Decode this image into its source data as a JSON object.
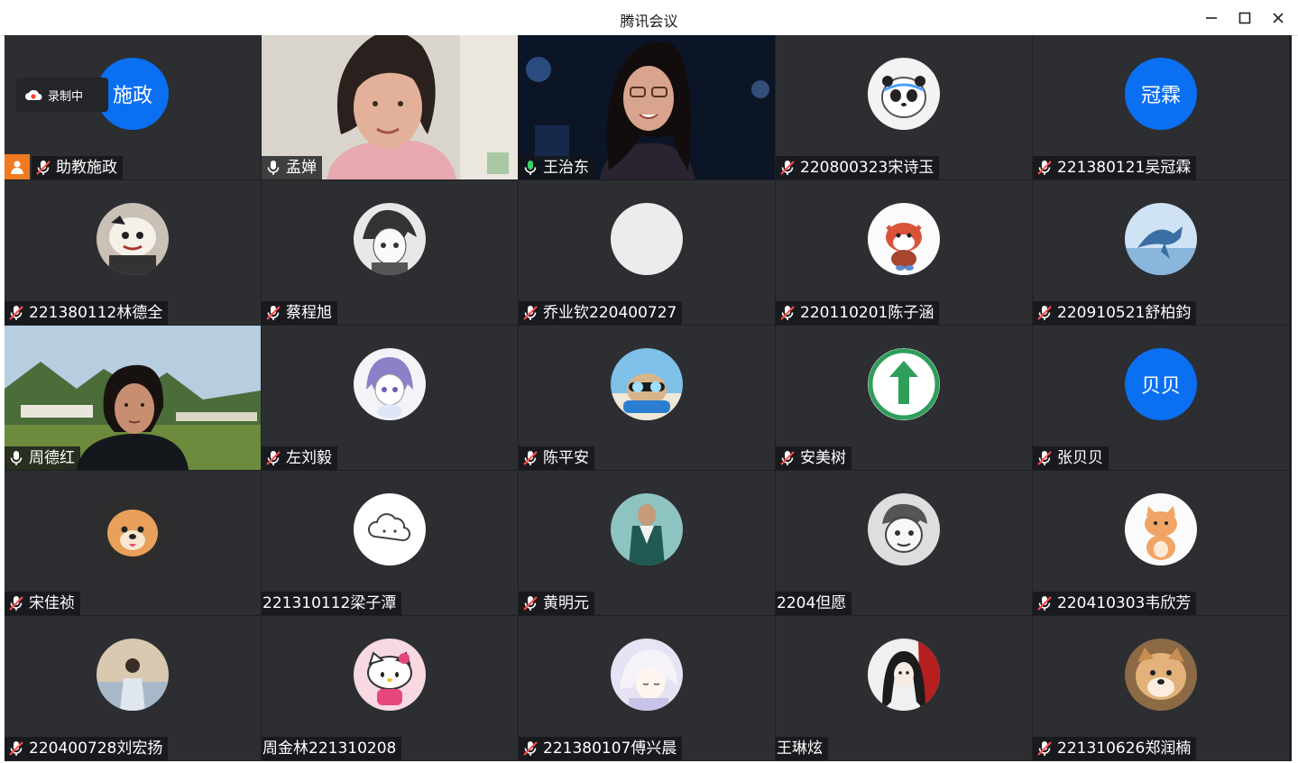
{
  "window": {
    "title": "腾讯会议"
  },
  "recording": {
    "label": "录制中"
  },
  "colors": {
    "accent": "#0b6ff2",
    "active_border": "#2fa46a",
    "mic_on": "#3ad46a",
    "muted": "#ff4d4f"
  },
  "participants": [
    {
      "name": "助教施政",
      "mic": "muted",
      "avatar_type": "text",
      "avatar_text": "施政",
      "host_badge": true
    },
    {
      "name": "孟婵",
      "mic": "on",
      "avatar_type": "video-woman-pink"
    },
    {
      "name": "王治东",
      "mic": "speaking",
      "avatar_type": "video-woman-dark",
      "active": true
    },
    {
      "name": "220800323宋诗玉",
      "mic": "muted",
      "avatar_type": "panda-icon"
    },
    {
      "name": "221380121吴冠霖",
      "mic": "muted",
      "avatar_type": "text",
      "avatar_text": "冠霖"
    },
    {
      "name": "221380112林德全",
      "mic": "muted",
      "avatar_type": "cartoon-plush-icon"
    },
    {
      "name": "蔡程旭",
      "mic": "muted",
      "avatar_type": "anime-boy-icon"
    },
    {
      "name": "乔业钦220400727",
      "mic": "muted",
      "avatar_type": "blank-avatar"
    },
    {
      "name": "220110201陈子涵",
      "mic": "muted",
      "avatar_type": "red-panda-icon"
    },
    {
      "name": "220910521舒柏鈞",
      "mic": "muted",
      "avatar_type": "whale-icon"
    },
    {
      "name": "周德红",
      "mic": "on",
      "avatar_type": "video-woman-landscape"
    },
    {
      "name": "左刘毅",
      "mic": "muted",
      "avatar_type": "anime-girl-icon"
    },
    {
      "name": "陈平安",
      "mic": "muted",
      "avatar_type": "pug-icon"
    },
    {
      "name": "安美树",
      "mic": "muted",
      "avatar_type": "green-arrow-icon"
    },
    {
      "name": "张贝贝",
      "mic": "muted",
      "avatar_type": "text",
      "avatar_text": "贝贝"
    },
    {
      "name": "宋佳祯",
      "mic": "muted",
      "avatar_type": "dog-icon"
    },
    {
      "name": "221310112梁子潭",
      "mic": "none",
      "avatar_type": "cloud-icon"
    },
    {
      "name": "黄明元",
      "mic": "muted",
      "avatar_type": "photo-man-icon"
    },
    {
      "name": "2204但愿",
      "mic": "none",
      "avatar_type": "sketch-boy-icon"
    },
    {
      "name": "220410303韦欣芳",
      "mic": "muted",
      "avatar_type": "cat-icon"
    },
    {
      "name": "220400728刘宏扬",
      "mic": "muted",
      "avatar_type": "person-back-icon"
    },
    {
      "name": "周金林221310208",
      "mic": "none",
      "avatar_type": "hello-kitty-icon"
    },
    {
      "name": "221380107傅兴晨",
      "mic": "muted",
      "avatar_type": "anime-sleep-icon"
    },
    {
      "name": "王琳炫",
      "mic": "none",
      "avatar_type": "anime-warrior-icon"
    },
    {
      "name": "221310626郑润楠",
      "mic": "muted",
      "avatar_type": "shiba-icon"
    }
  ]
}
